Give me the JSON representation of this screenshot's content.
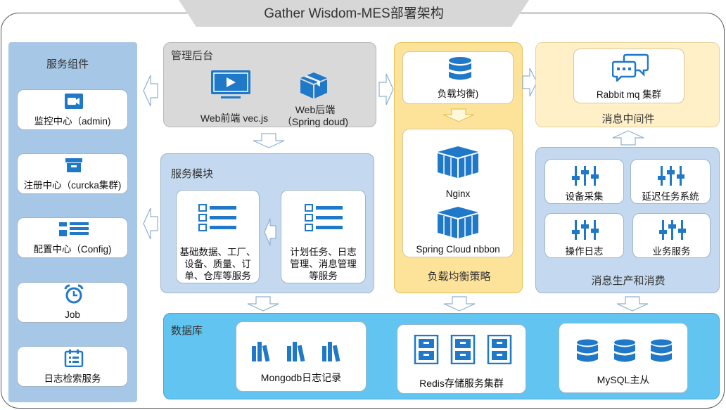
{
  "title": "Gather Wisdom-MES部署架构",
  "service_components": {
    "title": "服务组件",
    "items": [
      {
        "label": "监控中心（admin)",
        "icon": "video-camera-icon"
      },
      {
        "label": "注册中心（curcka集群)",
        "icon": "archive-box-icon"
      },
      {
        "label": "配置中心（Config)",
        "icon": "list-grid-icon"
      },
      {
        "label": "Job",
        "icon": "alarm-clock-icon"
      },
      {
        "label": "日志检索服务",
        "icon": "calendar-list-icon"
      }
    ]
  },
  "admin_backend": {
    "title": "管理后台",
    "web_frontend": "Web前端 vec.js",
    "web_backend_line1": "Web后端",
    "web_backend_line2": "（Spring doud)"
  },
  "service_modules": {
    "title": "服务模块",
    "module1_lines": [
      "基础数据、工厂、",
      "设备、质量、订",
      "单、仓库等服务"
    ],
    "module2_lines": [
      "计划任务、日志",
      "管理、消息管理",
      "等服务"
    ]
  },
  "load_balance": {
    "title": "负载均衡策略",
    "balancer_label": "负载均衡)",
    "nginx_label": "Nginx",
    "spring_label": "Spring Cloud nbbon"
  },
  "message_middleware": {
    "title": "消息中间件",
    "rabbit_label": "Rabbit mq 集群"
  },
  "message_production": {
    "title": "消息生产和消费",
    "items": [
      "设备采集",
      "延迟任务系统",
      "操作日志",
      "业务服务"
    ]
  },
  "database": {
    "title": "数据库",
    "mongodb_label": "Mongodb日志记录",
    "redis_label": "Redis存储服务集群",
    "mysql_label": "MySQL主从"
  },
  "colors": {
    "blue_icon": "#1f78c8",
    "left_panel": "#a7c7e7",
    "grey_panel": "#d9d9d9",
    "blue_panel": "#c4d9ef",
    "yellow_panel": "#fde39a",
    "cream_panel": "#fff0c8",
    "db_panel": "#62c4f0"
  }
}
